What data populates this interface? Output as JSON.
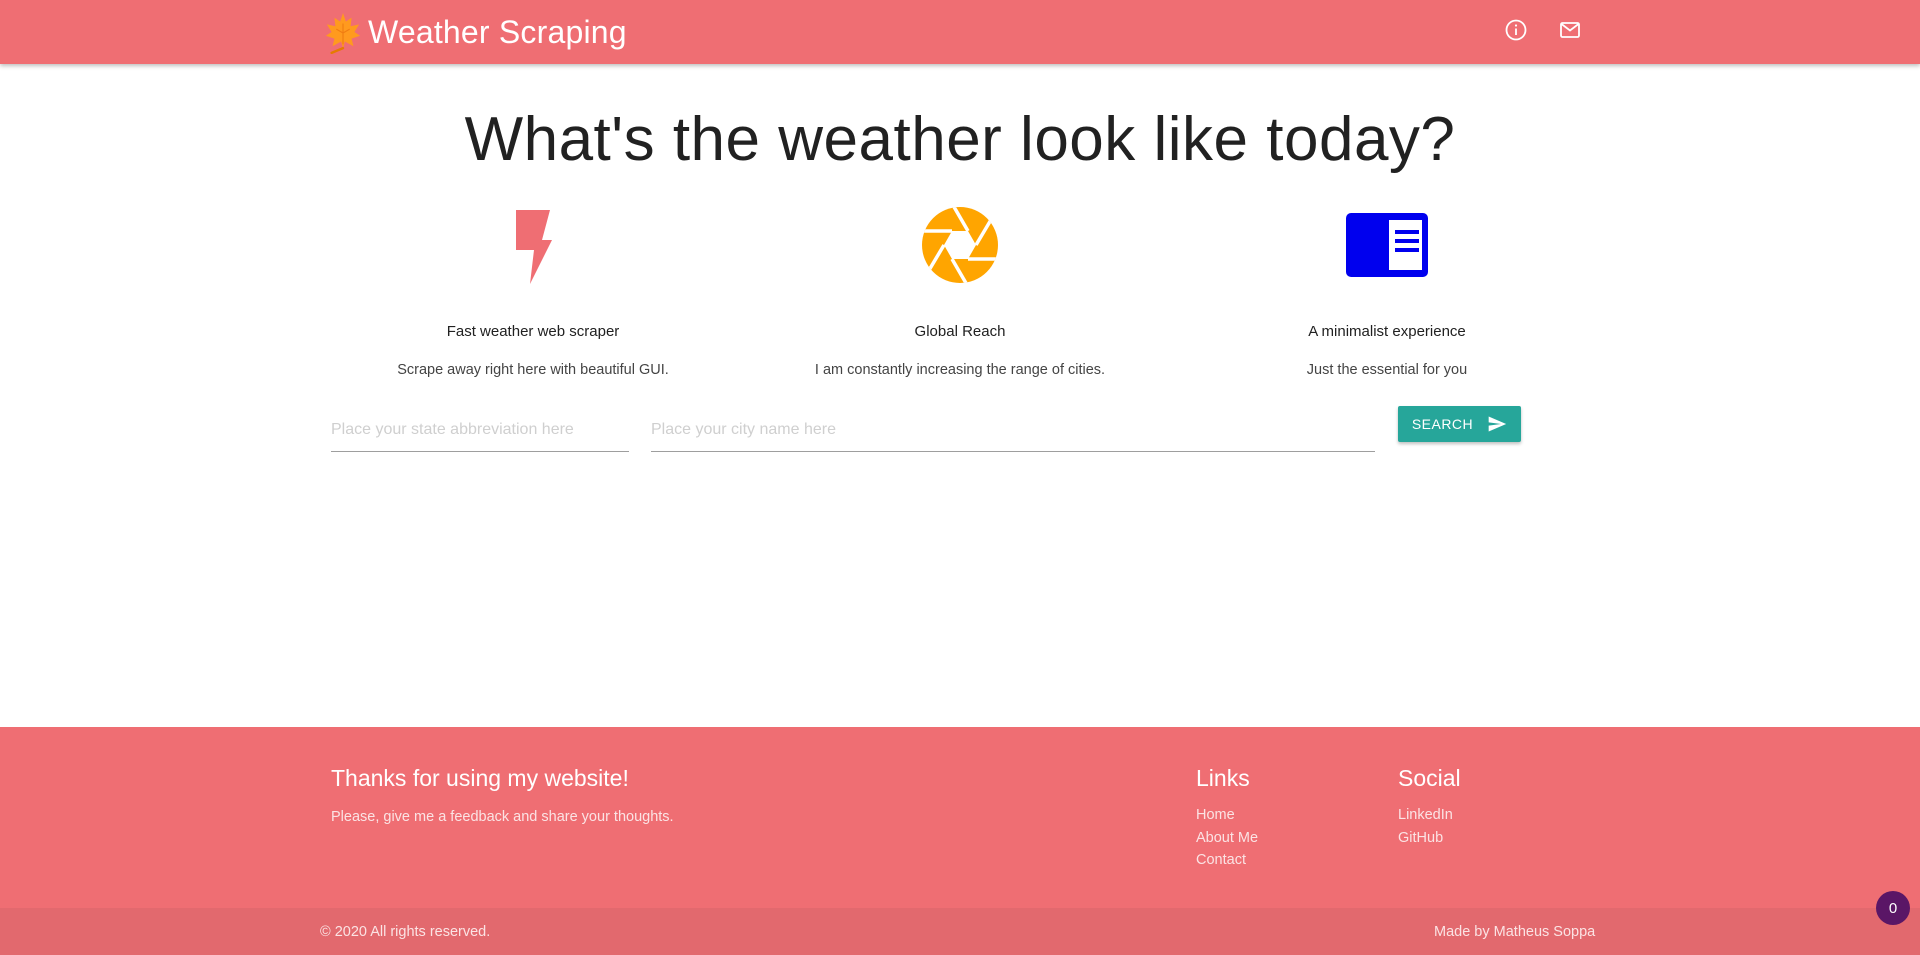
{
  "navbar": {
    "brand_text": "Weather Scraping",
    "logo_icon": "maple-leaf-icon",
    "icons": [
      "info-icon",
      "mail-icon"
    ],
    "color": "#ef6e73"
  },
  "hero": {
    "title": "What's the weather look like today?"
  },
  "features": [
    {
      "icon": "lightning-bolt-icon",
      "title": "Fast weather web scraper",
      "text": "Scrape away right here with beautiful GUI.",
      "color": "#ef6e73"
    },
    {
      "icon": "camera-shutter-icon",
      "title": "Global Reach",
      "text": "I am constantly increasing the range of cities.",
      "color": "#ffa500"
    },
    {
      "icon": "chrome-reader-icon",
      "title": "A minimalist experience",
      "text": "Just the essential for you",
      "color": "#0000ee"
    }
  ],
  "search": {
    "state_placeholder": "Place your state abbreviation here",
    "city_placeholder": "Place your city name here",
    "button_label": "SEARCH",
    "button_icon": "send-icon",
    "button_color": "#26a69a"
  },
  "footer": {
    "title": "Thanks for using my website!",
    "text": "Please, give me a feedback and share your thoughts.",
    "links": {
      "heading": "Links",
      "items": [
        "Home",
        "About Me",
        "Contact"
      ]
    },
    "social": {
      "heading": "Social",
      "items": [
        "LinkedIn",
        "GitHub"
      ]
    },
    "copyright": "© 2020 All rights reserved.",
    "made_by": "Made by Matheus Soppa"
  },
  "badge": {
    "count": "0"
  }
}
